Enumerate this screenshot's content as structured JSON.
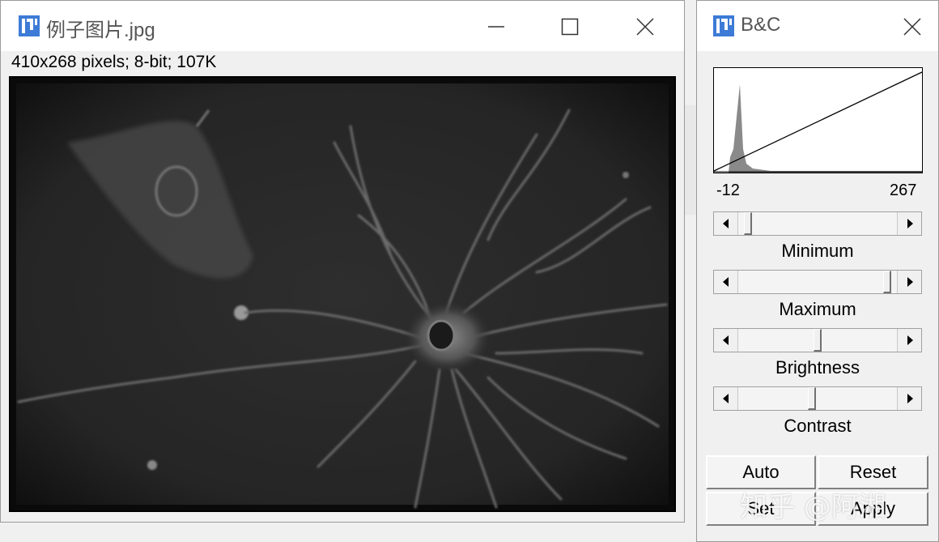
{
  "image_window": {
    "title": "例子图片.jpg",
    "info": "410x268 pixels; 8-bit; 107K",
    "controls": {
      "minimize": "minimize-icon",
      "maximize": "maximize-icon",
      "close": "close-icon"
    }
  },
  "bc_window": {
    "title": "B&C",
    "histogram": {
      "range_min": "-12",
      "range_max": "267"
    },
    "sliders": [
      {
        "label": "Minimum",
        "value": 0.04
      },
      {
        "label": "Maximum",
        "value": 0.96
      },
      {
        "label": "Brightness",
        "value": 0.5
      },
      {
        "label": "Contrast",
        "value": 0.46
      }
    ],
    "buttons": {
      "auto": "Auto",
      "reset": "Reset",
      "set": "Set",
      "apply": "Apply"
    }
  },
  "watermark": "知乎 @阿湘",
  "colors": {
    "titlebar": "#ffffff",
    "window": "#f0f0f0",
    "icon": "#3d7bd6"
  }
}
